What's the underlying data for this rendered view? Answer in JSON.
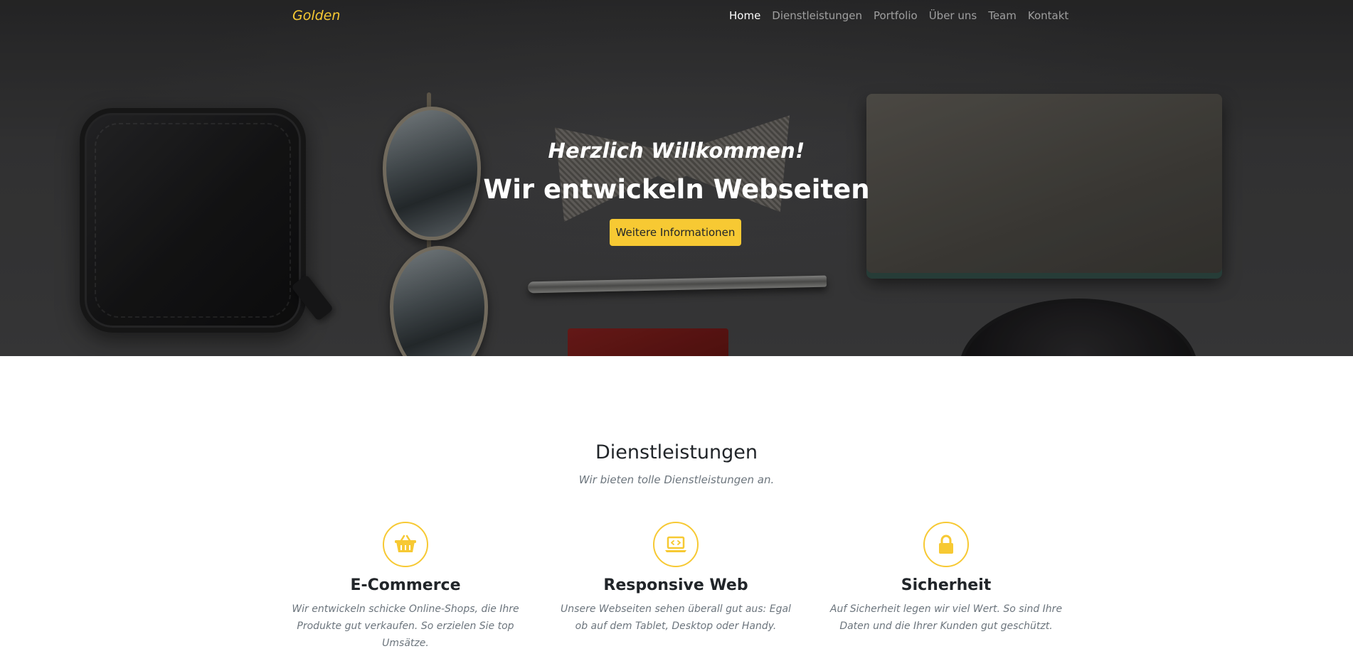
{
  "navbar": {
    "brand": "Golden",
    "links": [
      {
        "label": "Home",
        "active": true
      },
      {
        "label": "Dienstleistungen",
        "active": false
      },
      {
        "label": "Portfolio",
        "active": false
      },
      {
        "label": "Über uns",
        "active": false
      },
      {
        "label": "Team",
        "active": false
      },
      {
        "label": "Kontakt",
        "active": false
      }
    ]
  },
  "hero": {
    "welcome": "Herzlich Willkommen!",
    "title": "Wir entwickeln Webseiten",
    "button_label": "Weitere Informationen"
  },
  "services": {
    "title": "Dienstleistungen",
    "subtitle": "Wir bieten tolle Dienstleistungen an.",
    "items": [
      {
        "icon": "basket-icon",
        "title": "E-Commerce",
        "text": "Wir entwickeln schicke Online-Shops, die Ihre Produkte gut verkaufen. So erzielen Sie top Umsätze."
      },
      {
        "icon": "laptop-code-icon",
        "title": "Responsive Web",
        "text": "Unsere Webseiten sehen überall gut aus: Egal ob auf dem Tablet, Desktop oder Handy."
      },
      {
        "icon": "lock-icon",
        "title": "Sicherheit",
        "text": "Auf Sicherheit legen wir viel Wert. So sind Ihre Daten und die Ihrer Kunden gut geschützt."
      }
    ]
  },
  "colors": {
    "accent": "#f7c933",
    "nav_inactive": "rgba(255,255,255,0.55)",
    "text_muted": "#6c757d"
  }
}
